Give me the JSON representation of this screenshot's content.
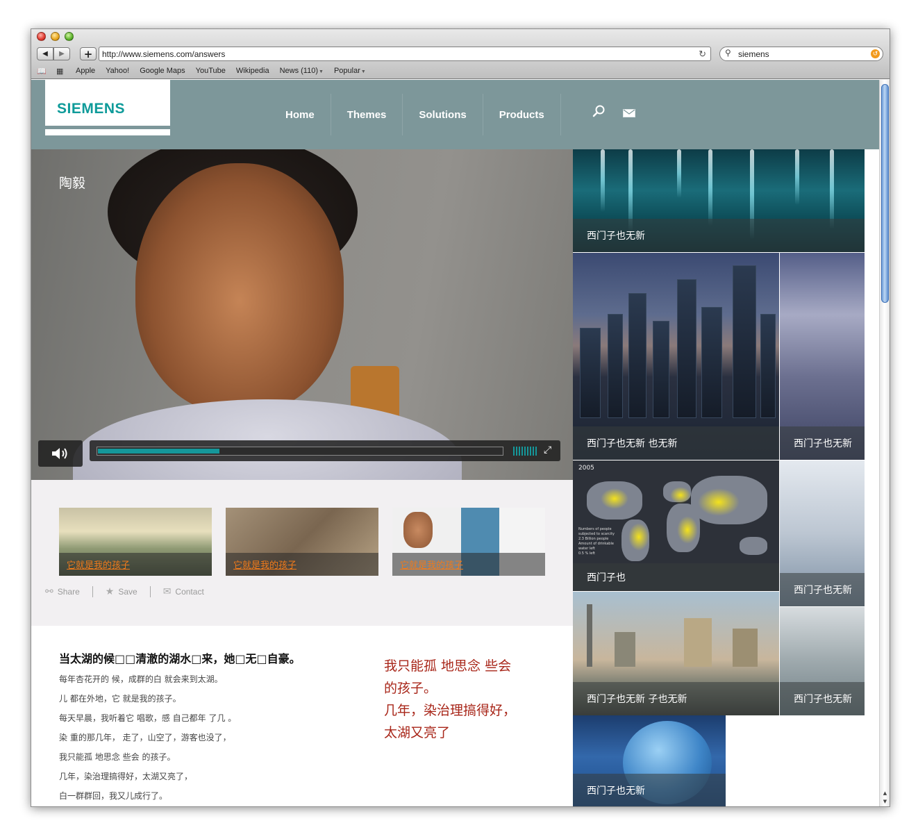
{
  "browser": {
    "url": "http://www.siemens.com/answers",
    "search_value": "siemens",
    "bookmarks": [
      "Apple",
      "Yahoo!",
      "Google Maps",
      "YouTube",
      "Wikipedia",
      "News (110)",
      "Popular"
    ]
  },
  "site": {
    "logo": "SIEMENS",
    "nav": [
      "Home",
      "Themes",
      "Solutions",
      "Products"
    ]
  },
  "hero": {
    "title": "陶毅",
    "progress": 0.3
  },
  "thumbnails": [
    {
      "label": "它就是我的孩子"
    },
    {
      "label": "它就是我的孩子"
    },
    {
      "label": "它就是我的孩子"
    }
  ],
  "actions": {
    "share": "Share",
    "save": "Save",
    "contact": "Contact"
  },
  "article": {
    "title": "当太湖的候□□清澈的湖水□来，她□无□自豪。",
    "lines": [
      "每年杏花开的 候，成群的白 就会来到太湖。",
      "儿 都在外地，它 就是我的孩子。",
      "每天早晨，我听着它 唱歌，感 自己都年 了几 。",
      " 染 重的那几年，  走了，山空了，游客也没了，",
      "我只能孤 地思念 些会 的孩子。",
      "几年，染治理搞得好，太湖又亮了，",
      "白一群群回，我又儿成行了。"
    ],
    "quote": [
      "我只能孤 地思念 些会",
      "的孩子。",
      "几年，染治理搞得好，",
      "太湖又亮了"
    ]
  },
  "tiles": {
    "water": "西门子也无新",
    "city": "西门子也无新 也无新",
    "plant": "西门子也无新",
    "map": "西门子也",
    "map_year": "2005",
    "map_legend": [
      "Numbers of people subjected to scarcity",
      "2.3 Billion people",
      "Amount of drinkable water left",
      "0.5 % left"
    ],
    "machine": "西门子也无新",
    "shanghai": "西门子也无新 子也无新",
    "tanks": "西门子也无新",
    "sphere": "西门子也无新"
  },
  "colors": {
    "accent_teal": "#0f9b9a",
    "header_gray": "#7d979a",
    "link_orange": "#f07a1a",
    "quote_red": "#a82619"
  }
}
